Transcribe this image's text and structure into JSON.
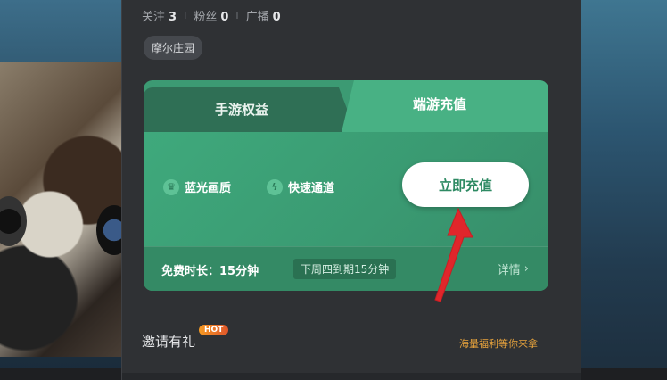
{
  "stats": {
    "follow_label": "关注",
    "follow_count": "3",
    "fans_label": "粉丝",
    "fans_count": "0",
    "broadcast_label": "广播",
    "broadcast_count": "0",
    "separator": "I"
  },
  "tag": "摩尔庄园",
  "card": {
    "tab_mobile": "手游权益",
    "tab_pc": "端游充值",
    "features": [
      {
        "icon": "crown-icon",
        "label": "蓝光画质"
      },
      {
        "icon": "lightning-icon",
        "label": "快速通道"
      }
    ],
    "recharge_button": "立即充值",
    "free_time_label": "免费时长：15分钟",
    "reset_note": "下周四到期15分钟",
    "details_link": "详情",
    "accent": "#3c9a73"
  },
  "invite": {
    "title": "邀请有礼",
    "badge": "HOT",
    "hint": "海量福利等你来拿"
  },
  "annotation_color": "#e0262b"
}
